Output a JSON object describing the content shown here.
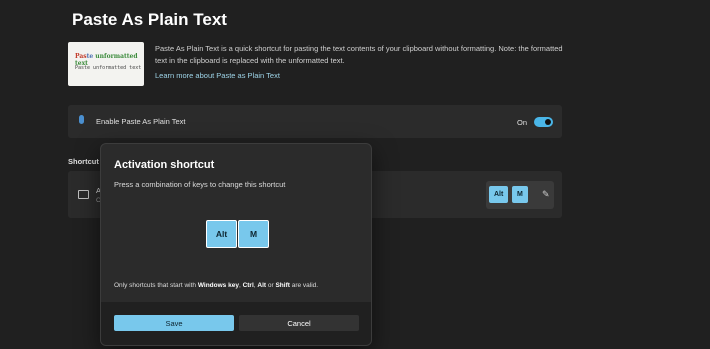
{
  "page": {
    "title": "Paste As Plain Text"
  },
  "hero": {
    "image_caption_line1": "Paste unformatted text",
    "image_caption_line2": "Paste unformatted text",
    "description": "Paste As Plain Text is a quick shortcut for pasting the text contents of your clipboard without formatting. Note: the formatted text in the clipboard is replaced with the unformatted text.",
    "learn_more": "Learn more about Paste as Plain Text"
  },
  "enable": {
    "icon": "clipboard-icon",
    "label": "Enable Paste As Plain Text",
    "state": "On",
    "toggled": true
  },
  "shortcut_section": {
    "label": "Shortcut",
    "row_title": "A",
    "row_sub": "C",
    "keys": [
      "Alt",
      "M"
    ],
    "edit_icon": "pencil-icon"
  },
  "dialog": {
    "title": "Activation shortcut",
    "subtitle": "Press a combination of keys to change this shortcut",
    "keys": [
      "Alt",
      "M"
    ],
    "note_prefix": "Only shortcuts that start with ",
    "note_k1": "Windows key",
    "note_sep1": ", ",
    "note_k2": "Ctrl",
    "note_sep2": ", ",
    "note_k3": "Alt",
    "note_sep3": " or ",
    "note_k4": "Shift",
    "note_suffix": " are valid.",
    "save_label": "Save",
    "cancel_label": "Cancel"
  },
  "colors": {
    "accent": "#78c8ec",
    "toggle_on": "#4ab6e8",
    "background": "#202020",
    "card": "#2b2b2b"
  }
}
